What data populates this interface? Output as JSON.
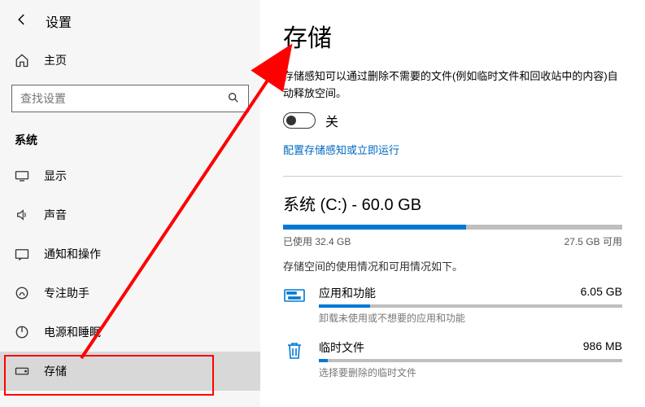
{
  "topbar": {
    "settings": "设置"
  },
  "home": {
    "label": "主页"
  },
  "search": {
    "placeholder": "查找设置"
  },
  "section": {
    "title": "系统"
  },
  "nav": [
    {
      "key": "display",
      "label": "显示"
    },
    {
      "key": "sound",
      "label": "声音"
    },
    {
      "key": "notifications",
      "label": "通知和操作"
    },
    {
      "key": "focus",
      "label": "专注助手"
    },
    {
      "key": "power",
      "label": "电源和睡眠"
    },
    {
      "key": "storage",
      "label": "存储",
      "selected": true
    }
  ],
  "page": {
    "title": "存储",
    "desc": "存储感知可以通过删除不需要的文件(例如临时文件和回收站中的内容)自动释放空间。",
    "toggle_state": "关",
    "config_link": "配置存储感知或立即运行",
    "drive": {
      "title": "系统 (C:) - 60.0 GB",
      "used_label": "已使用 32.4 GB",
      "free_label": "27.5 GB 可用",
      "fill_percent": 54,
      "usage_desc": "存储空间的使用情况和可用情况如下。"
    },
    "categories": [
      {
        "key": "apps",
        "name": "应用和功能",
        "size": "6.05 GB",
        "sub": "卸载未使用或不想要的应用和功能",
        "fill_percent": 17
      },
      {
        "key": "temp",
        "name": "临时文件",
        "size": "986 MB",
        "sub": "选择要删除的临时文件",
        "fill_percent": 3
      }
    ]
  },
  "chart_data": {
    "type": "bar",
    "title": "系统 (C:) - 60.0 GB",
    "total_gb": 60.0,
    "used_gb": 32.4,
    "free_gb": 27.5,
    "categories": [
      {
        "name": "应用和功能",
        "value_gb": 6.05
      },
      {
        "name": "临时文件",
        "value_gb": 0.986
      }
    ]
  }
}
